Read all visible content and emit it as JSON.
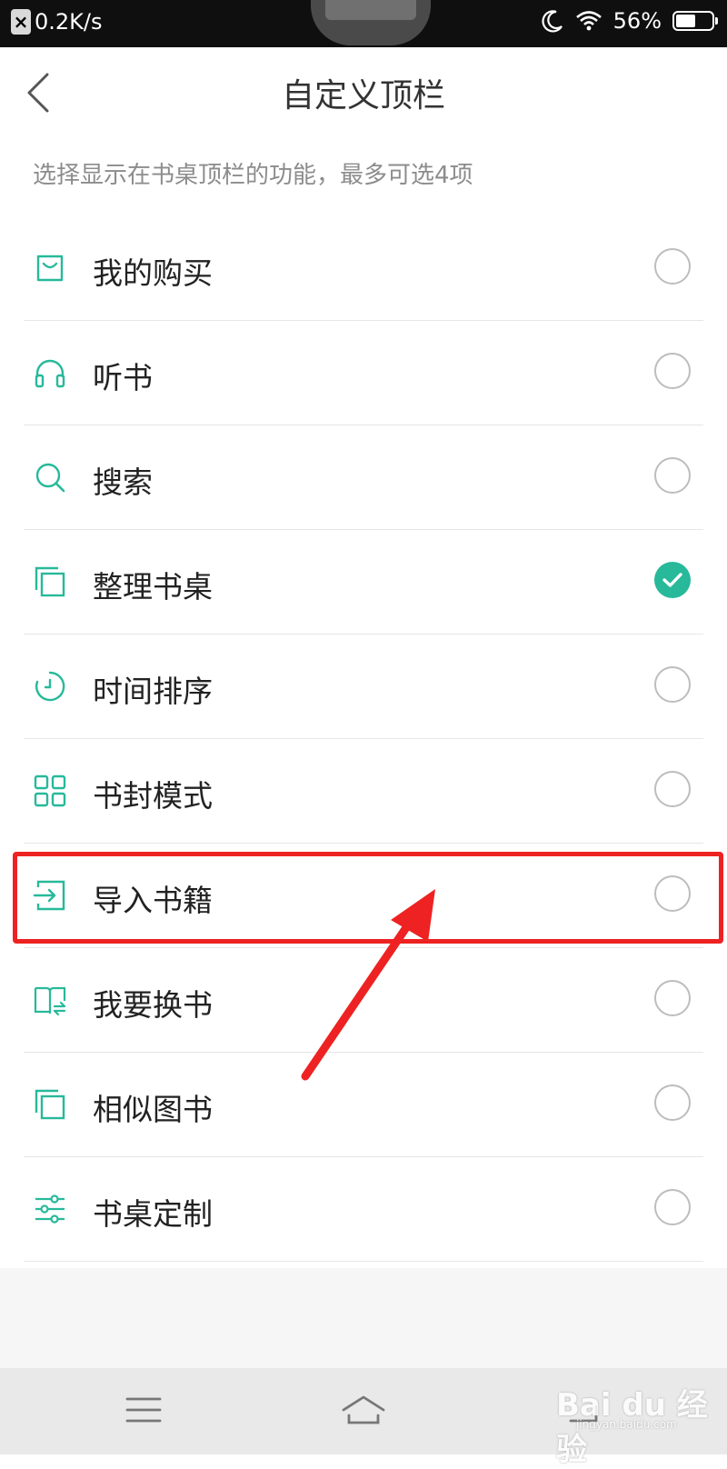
{
  "status_bar": {
    "speed": "0.2K/s",
    "battery": "56%",
    "battery_level": 0.56,
    "icons": [
      "close-icon",
      "moon-icon",
      "wifi-icon",
      "battery-icon"
    ]
  },
  "header": {
    "title": "自定义顶栏",
    "back_icon": "chevron-left-icon"
  },
  "subtitle": "选择显示在书桌顶栏的功能，最多可选4项",
  "items": [
    {
      "label": "我的购买",
      "icon": "shopping-bag-icon",
      "checked": false
    },
    {
      "label": "听书",
      "icon": "headphones-icon",
      "checked": false
    },
    {
      "label": "搜索",
      "icon": "search-icon",
      "checked": false
    },
    {
      "label": "整理书桌",
      "icon": "copy-icon",
      "checked": true
    },
    {
      "label": "时间排序",
      "icon": "clock-icon",
      "checked": false
    },
    {
      "label": "书封模式",
      "icon": "grid-icon",
      "checked": false
    },
    {
      "label": "导入书籍",
      "icon": "import-icon",
      "checked": false
    },
    {
      "label": "我要换书",
      "icon": "book-swap-icon",
      "checked": false
    },
    {
      "label": "相似图书",
      "icon": "copy-icon",
      "checked": false
    },
    {
      "label": "书桌定制",
      "icon": "sliders-icon",
      "checked": false
    }
  ],
  "colors": {
    "accent": "#27b99a",
    "highlight": "#ee2222"
  },
  "nav": {
    "icons": [
      "menu-icon",
      "home-icon",
      "back-icon"
    ]
  },
  "watermark": {
    "text": "Bai du 经验",
    "sub": "jingyan.baidu.com"
  }
}
